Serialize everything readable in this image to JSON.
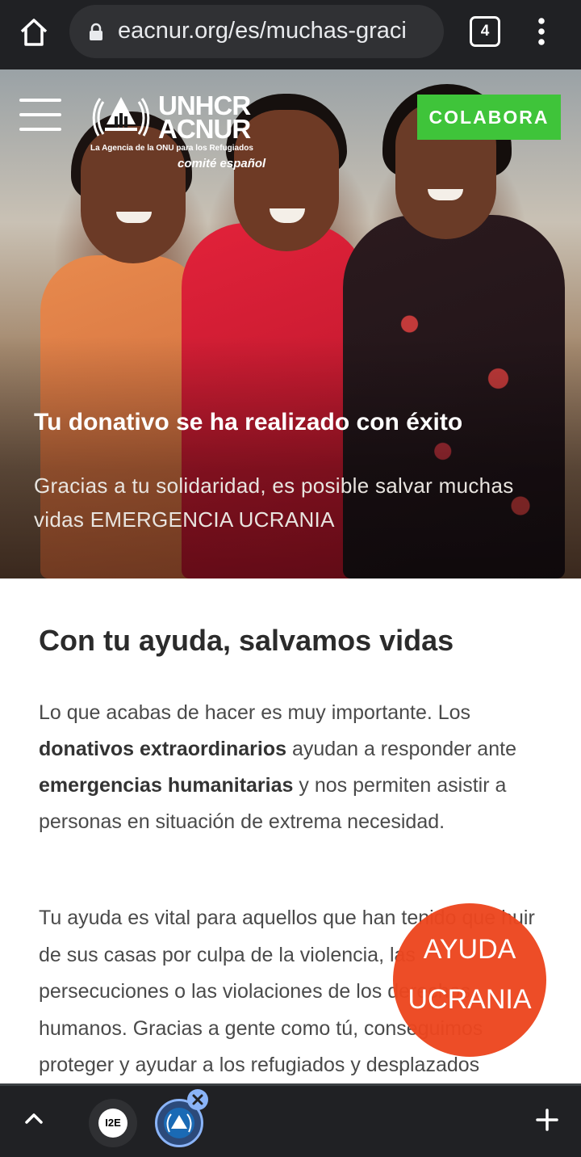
{
  "browser": {
    "url": "eacnur.org/es/muchas-graci",
    "tab_count": "4"
  },
  "header": {
    "logo_main_line1": "UNHCR",
    "logo_main_line2": "ACNUR",
    "logo_tagline": "La Agencia de la ONU para los Refugiados",
    "logo_subtitle": "comité español",
    "cta_label": "COLABORA"
  },
  "hero": {
    "title": "Tu donativo se ha realizado con éxito",
    "subtitle": "Gracias a tu solidaridad, es posible salvar muchas vidas EMERGENCIA UCRANIA"
  },
  "main": {
    "section_title": "Con tu ayuda, salvamos vidas",
    "para1": {
      "t1": "Lo que acabas de hacer es muy importante. Los ",
      "b1": "donativos extraordinarios",
      "t2": " ayudan a responder ante ",
      "b2": "emergencias humanitarias",
      "t3": " y nos permiten asistir a personas en situación de extrema necesidad."
    },
    "para2": "Tu ayuda es vital para aquellos que han tenido que huir de sus casas por culpa de la violencia, las persecuciones o las violaciones de los derechos humanos. Gracias a gente como tú, conseguimos proteger y ayudar a los refugiados y desplazados"
  },
  "floating_button": {
    "line1": "AYUDA",
    "line2": "UCRANIA"
  },
  "tab_strip": {
    "tab1_badge": "I2E"
  },
  "colors": {
    "cta_green": "#3fc43a",
    "ayuda_orange": "#ec461e",
    "browser_dark": "#202124"
  },
  "icons": [
    "home-icon",
    "lock-icon",
    "tabs-icon",
    "more-vert-icon",
    "hamburger-icon",
    "unhcr-emblem-icon",
    "chevron-up-icon",
    "close-icon",
    "plus-icon"
  ]
}
